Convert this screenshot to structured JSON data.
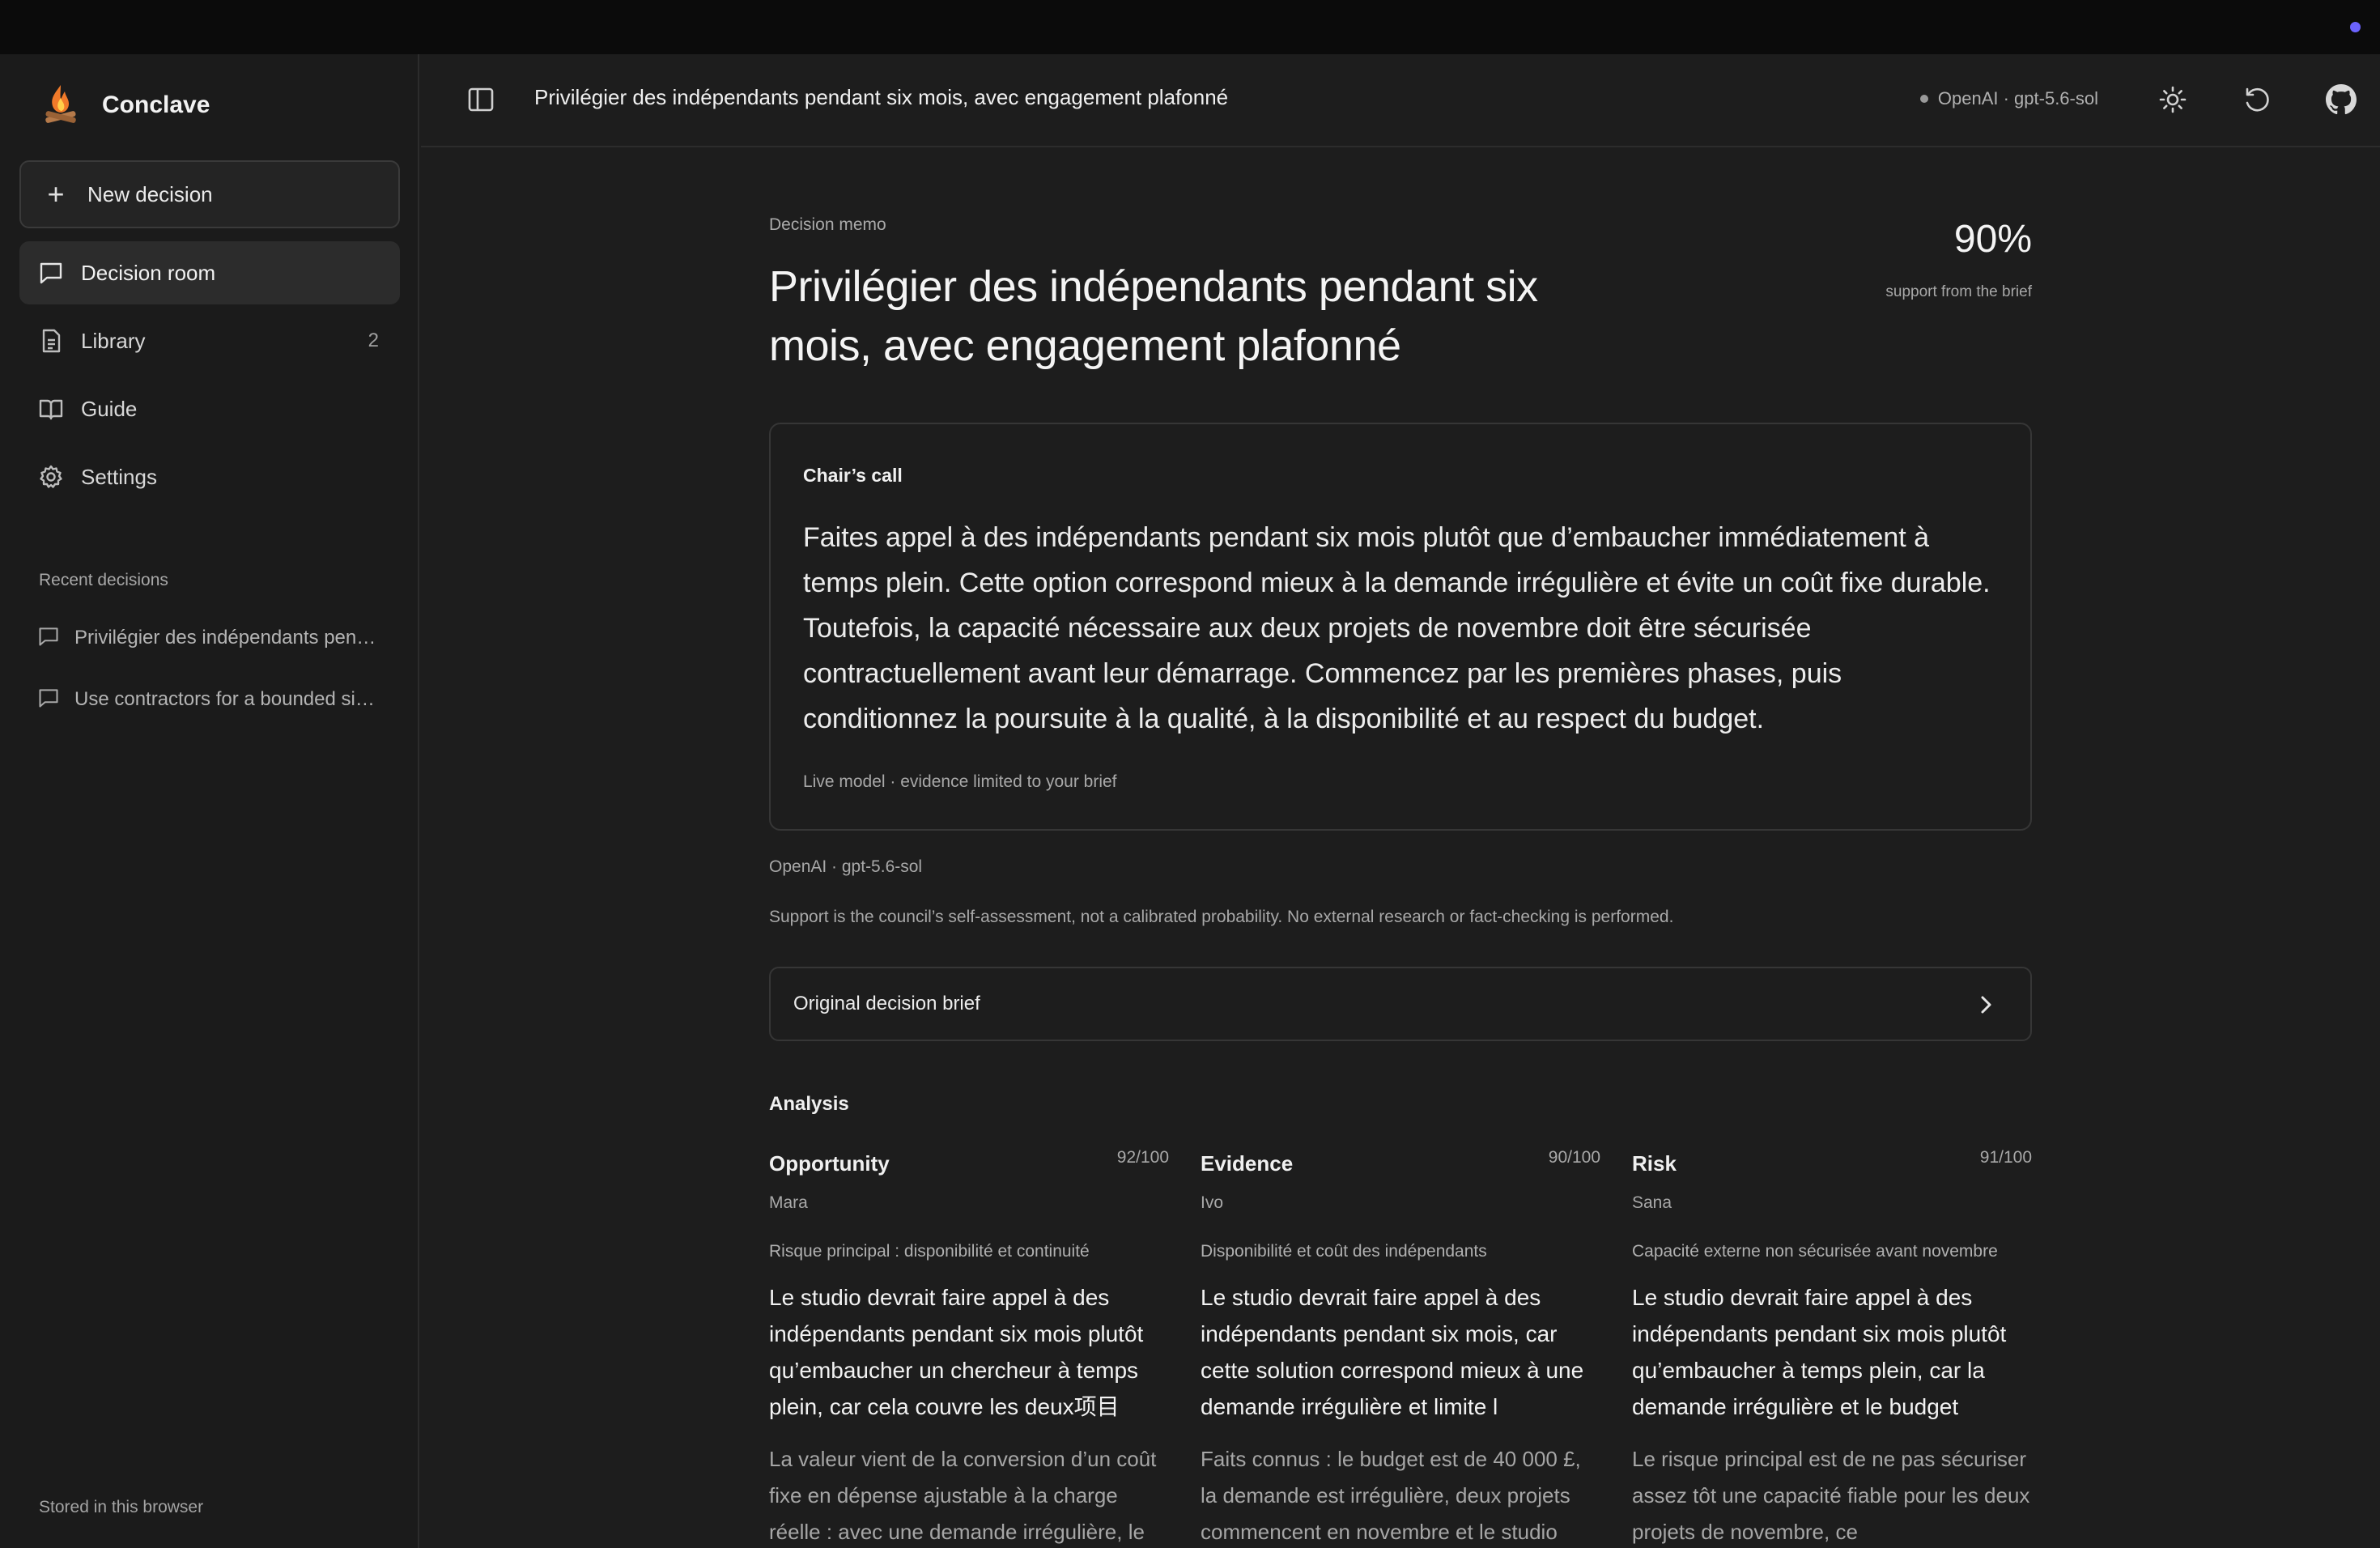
{
  "app": {
    "name": "Conclave"
  },
  "sidebar": {
    "new_button": "New decision",
    "nav": [
      {
        "label": "Decision room",
        "icon": "chat-bubble-icon",
        "active": true
      },
      {
        "label": "Library",
        "icon": "document-icon",
        "count": "2"
      },
      {
        "label": "Guide",
        "icon": "book-icon"
      },
      {
        "label": "Settings",
        "icon": "gear-icon"
      }
    ],
    "recent_title": "Recent decisions",
    "recent": [
      {
        "label": "Privilégier des indépendants pendant six mois, avec engagement plafonné"
      },
      {
        "label": "Use contractors for a bounded six-month engagement"
      }
    ],
    "footer": "Stored in this browser"
  },
  "header": {
    "title": "Privilégier des indépendants pendant six mois, avec engagement plafonné",
    "model": "OpenAI · gpt-5.6-sol",
    "icons": [
      "sidebar-toggle-icon",
      "sun-icon",
      "refresh-icon",
      "github-icon"
    ]
  },
  "memo": {
    "label": "Decision memo",
    "title": "Privilégier des indépendants pendant six mois, avec engagement plafonné",
    "support_pct": "90%",
    "support_label": "support from the brief"
  },
  "chair": {
    "heading": "Chair’s call",
    "body": "Faites appel à des indépendants pendant six mois plutôt que d’embaucher immédiatement à temps plein. Cette option correspond mieux à la demande irrégulière et évite un coût fixe durable. Toutefois, la capacité nécessaire aux deux projets de novembre doit être sécurisée contractuellement avant leur démarrage. Commencez par les premières phases, puis conditionnez la poursuite à la qualité, à la disponibilité et au respect du budget.",
    "footer": "Live model · evidence limited to your brief"
  },
  "model_line": "OpenAI · gpt-5.6-sol",
  "disclaimer": "Support is the council’s self-assessment, not a calibrated probability. No external research or fact-checking is performed.",
  "brief_row": {
    "label": "Original decision brief"
  },
  "analysis": {
    "title": "Analysis",
    "columns": [
      {
        "name": "Opportunity",
        "score": "92/100",
        "agent": "Mara",
        "topic": "Risque principal : disponibilité et continuité",
        "claim": "Le studio devrait faire appel à des indépendants pendant six mois plutôt qu’embaucher un chercheur à temps plein, car cela couvre les deux项目",
        "detail": "La valeur vient de la conversion d’un coût fixe en dépense ajustable à la charge réelle : avec une demande irrégulière, le"
      },
      {
        "name": "Evidence",
        "score": "90/100",
        "agent": "Ivo",
        "topic": "Disponibilité et coût des indépendants",
        "claim": "Le studio devrait faire appel à des indépendants pendant six mois, car cette solution correspond mieux à une demande irrégulière et limite l",
        "detail": "Faits connus : le budget est de 40 000 £, la demande est irrégulière, deux projets commencent en novembre et le studio"
      },
      {
        "name": "Risk",
        "score": "91/100",
        "agent": "Sana",
        "topic": "Capacité externe non sécurisée avant novembre",
        "claim": "Le studio devrait faire appel à des indépendants pendant six mois plutôt qu’embaucher à temps plein, car la demande irrégulière et le budget",
        "detail": "Le risque principal est de ne pas sécuriser assez tôt une capacité fiable pour les deux projets de novembre, ce"
      }
    ]
  },
  "colors": {
    "accent": "#6c63ff",
    "background": "#1d1d1d",
    "sidebar": "#1b1b1b"
  }
}
